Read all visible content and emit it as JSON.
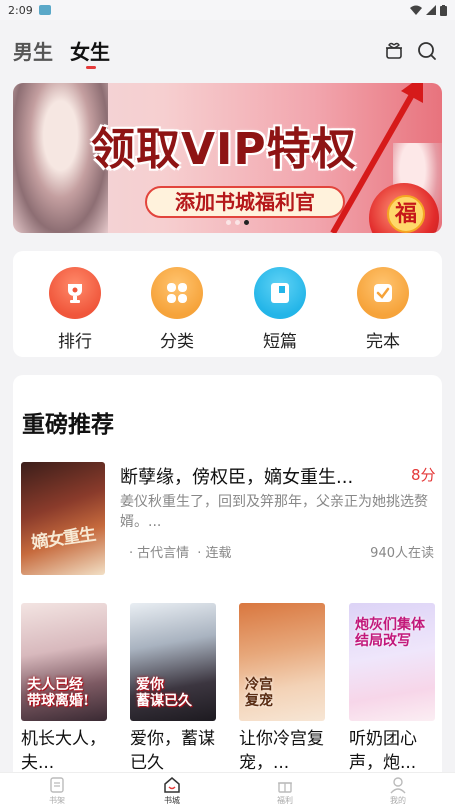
{
  "status_bar": {
    "time": "2:09"
  },
  "top_nav": {
    "tabs": [
      "男生",
      "女生"
    ],
    "active_tab": "女生"
  },
  "banner": {
    "title": "领取VIP特权",
    "subtitle": "添加书城福利官",
    "badge": "福"
  },
  "quick_links": [
    {
      "label": "排行",
      "icon": "trophy-icon",
      "color": "#f0563b"
    },
    {
      "label": "分类",
      "icon": "grid-icon",
      "color": "#f6a33a"
    },
    {
      "label": "短篇",
      "icon": "note-icon",
      "color": "#23b5e8"
    },
    {
      "label": "完本",
      "icon": "check-icon",
      "color": "#f6a33a"
    }
  ],
  "recommend": {
    "title": "重磅推荐",
    "featured": {
      "title": "断孽缘，傍权臣，嫡女重生...",
      "score": "8分",
      "desc": "姜仪秋重生了，回到及笄那年，父亲正为她挑选赘婿。...",
      "genre": "古代言情",
      "status": "连载",
      "readers": "940人在读",
      "cover_text": "嫡女重生"
    },
    "books": [
      {
        "title": "机长大人，夫...",
        "cover_text": "夫人已经\n带球离婚!"
      },
      {
        "title": "爱你，蓄谋已久",
        "cover_text": "爱你\n蓄谋已久"
      },
      {
        "title": "让你冷宫复宠，...",
        "cover_text": "冷宫\n复宠"
      },
      {
        "title": "听奶团心声，炮...",
        "cover_text": "炮灰们集体\n结局改写"
      }
    ]
  },
  "bottom_tabs": [
    {
      "label": "书架",
      "icon": "bookshelf-icon",
      "active": false
    },
    {
      "label": "书城",
      "icon": "store-icon",
      "active": true
    },
    {
      "label": "福利",
      "icon": "gift-icon",
      "active": false
    },
    {
      "label": "我的",
      "icon": "user-icon",
      "active": false
    }
  ]
}
